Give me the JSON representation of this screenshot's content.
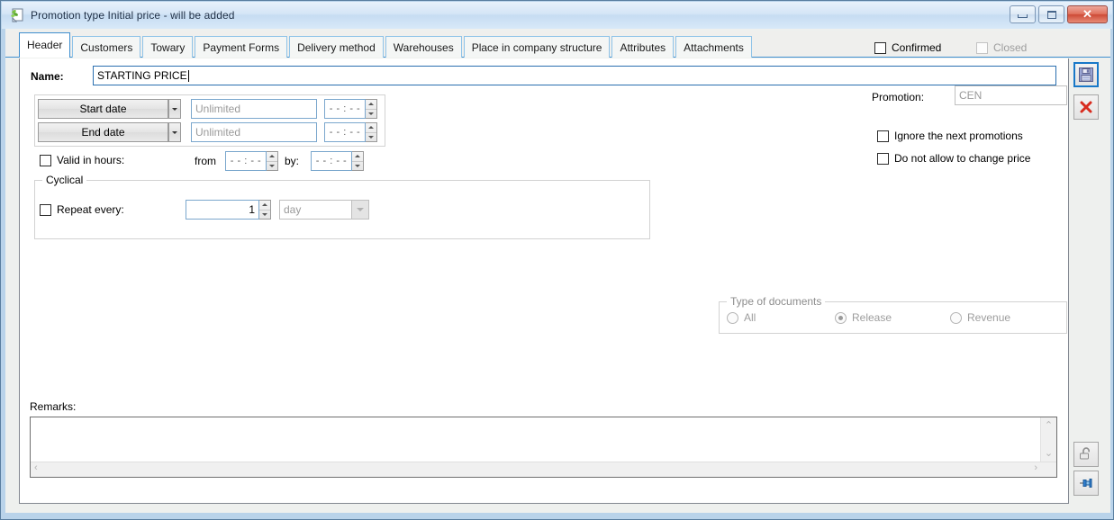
{
  "window": {
    "title": "Promotion type Initial price - will be added",
    "icon": "promotion-document-icon",
    "minimize_label": "minimize",
    "maximize_label": "maximize",
    "close_label": "✕"
  },
  "tabs": [
    {
      "label": "Header",
      "active": true
    },
    {
      "label": "Customers",
      "active": false
    },
    {
      "label": "Towary",
      "active": false
    },
    {
      "label": "Payment Forms",
      "active": false
    },
    {
      "label": "Delivery method",
      "active": false
    },
    {
      "label": "Warehouses",
      "active": false
    },
    {
      "label": "Place in company structure",
      "active": false
    },
    {
      "label": "Attributes",
      "active": false
    },
    {
      "label": "Attachments",
      "active": false
    }
  ],
  "header_checks": {
    "confirmed": {
      "label": "Confirmed",
      "checked": false,
      "enabled": true
    },
    "closed": {
      "label": "Closed",
      "checked": false,
      "enabled": false
    }
  },
  "name_field": {
    "label": "Name:",
    "value": "STARTING PRICE",
    "placeholder": ""
  },
  "dates": {
    "start": {
      "button_label": "Start date",
      "date_placeholder": "Unlimited",
      "date_value": "",
      "time_value": "- - : - -"
    },
    "end": {
      "button_label": "End date",
      "date_placeholder": "Unlimited",
      "date_value": "",
      "time_value": "- - : - -"
    },
    "valid_in_hours": {
      "label": "Valid in hours:",
      "checked": false,
      "from_label": "from",
      "from_value": "- - : - -",
      "by_label": "by:",
      "by_value": "- - : - -"
    }
  },
  "cyclical": {
    "title": "Cyclical",
    "repeat": {
      "label": "Repeat every:",
      "checked": false,
      "count_value": "1",
      "unit_value": "day"
    }
  },
  "promotion": {
    "label": "Promotion:",
    "value": "CEN"
  },
  "right_checks": [
    {
      "label": "Ignore the next promotions",
      "checked": false
    },
    {
      "label": "Do not allow to change price",
      "checked": false
    }
  ],
  "type_of_documents": {
    "title": "Type of documents",
    "options": [
      {
        "label": "All",
        "selected": false
      },
      {
        "label": "Release",
        "selected": true
      },
      {
        "label": "Revenue",
        "selected": false
      }
    ]
  },
  "remarks": {
    "label": "Remarks:",
    "value": "",
    "scroll_left_glyph": "‹",
    "scroll_right_glyph": "›",
    "scroll_up_glyph": "⌃",
    "scroll_down_glyph": "⌄"
  },
  "side_buttons": [
    {
      "name": "save-button",
      "icon": "floppy-disk-icon",
      "focused": true
    },
    {
      "name": "cancel-button",
      "icon": "red-x-icon",
      "focused": false
    },
    {
      "name": "lock-button",
      "icon": "open-padlock-icon",
      "focused": false
    },
    {
      "name": "pin-button",
      "icon": "pin-icon",
      "focused": false
    }
  ],
  "colors": {
    "window_frame": "#b9d3ea",
    "tab_active_border": "#3f8fcf",
    "accent_blue": "#1878c8",
    "close_red": "#cd4a36",
    "disabled_text": "#9d9d9d"
  }
}
